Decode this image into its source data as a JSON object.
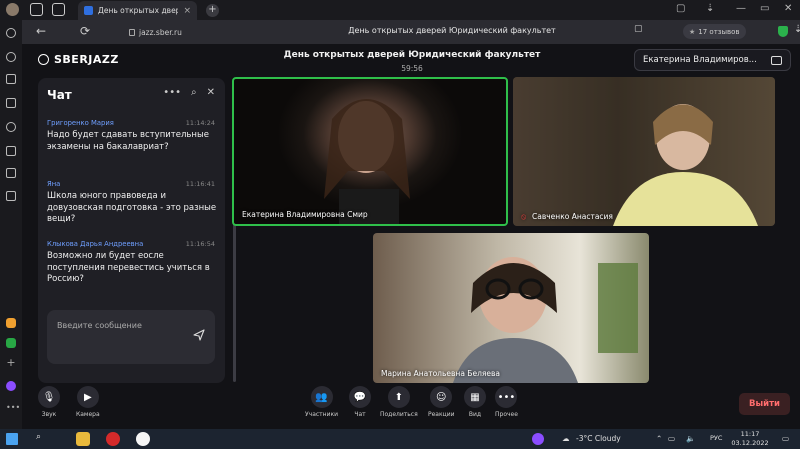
{
  "browser": {
    "tab_title": "День открытых двер",
    "url": "jazz.sber.ru",
    "page_title": "День открытых дверей Юридический факультет",
    "reviews": "17 отзывов"
  },
  "app": {
    "logo": "SBERJAZZ",
    "conference_title": "День открытых дверей Юридический факультет",
    "timer": "59:56",
    "user_chip": "Екатерина Владимиров..."
  },
  "chat": {
    "title": "Чат",
    "messages": [
      {
        "author": "Григоренко Мария",
        "time": "11:14:24",
        "text": "Надо будет сдавать вступительные экзамены на бакалавриат?"
      },
      {
        "author": "Яна",
        "time": "11:16:41",
        "text": "Школа юного правоведа и довузовская подготовка - это разные вещи?"
      },
      {
        "author": "Клыкова Дарья Андреевна",
        "time": "11:16:54",
        "text": "Возможно ли будет еосле поступления перевестись учиться в Россию?"
      }
    ],
    "input_placeholder": "Введите сообщение"
  },
  "participants": [
    {
      "name": "Екатерина Владимировна Смир"
    },
    {
      "name": "Савченко Анастасия",
      "muted": true
    },
    {
      "name": "Марина Анатольевна Беляева"
    }
  ],
  "toolbar": {
    "sound": "Звук",
    "camera": "Камера",
    "participants": "Участники",
    "chat": "Чат",
    "share": "Поделиться",
    "reactions": "Реакции",
    "view": "Вид",
    "more": "Прочее",
    "exit": "Выйти"
  },
  "taskbar": {
    "weather": "-3°C  Cloudy",
    "lang": "РУС",
    "time": "11:17",
    "date": "03.12.2022"
  },
  "colors": {
    "accent_author": "#6f9fff",
    "active_speaker_border": "#2fbf4a",
    "exit_text": "#ff6d6d"
  }
}
